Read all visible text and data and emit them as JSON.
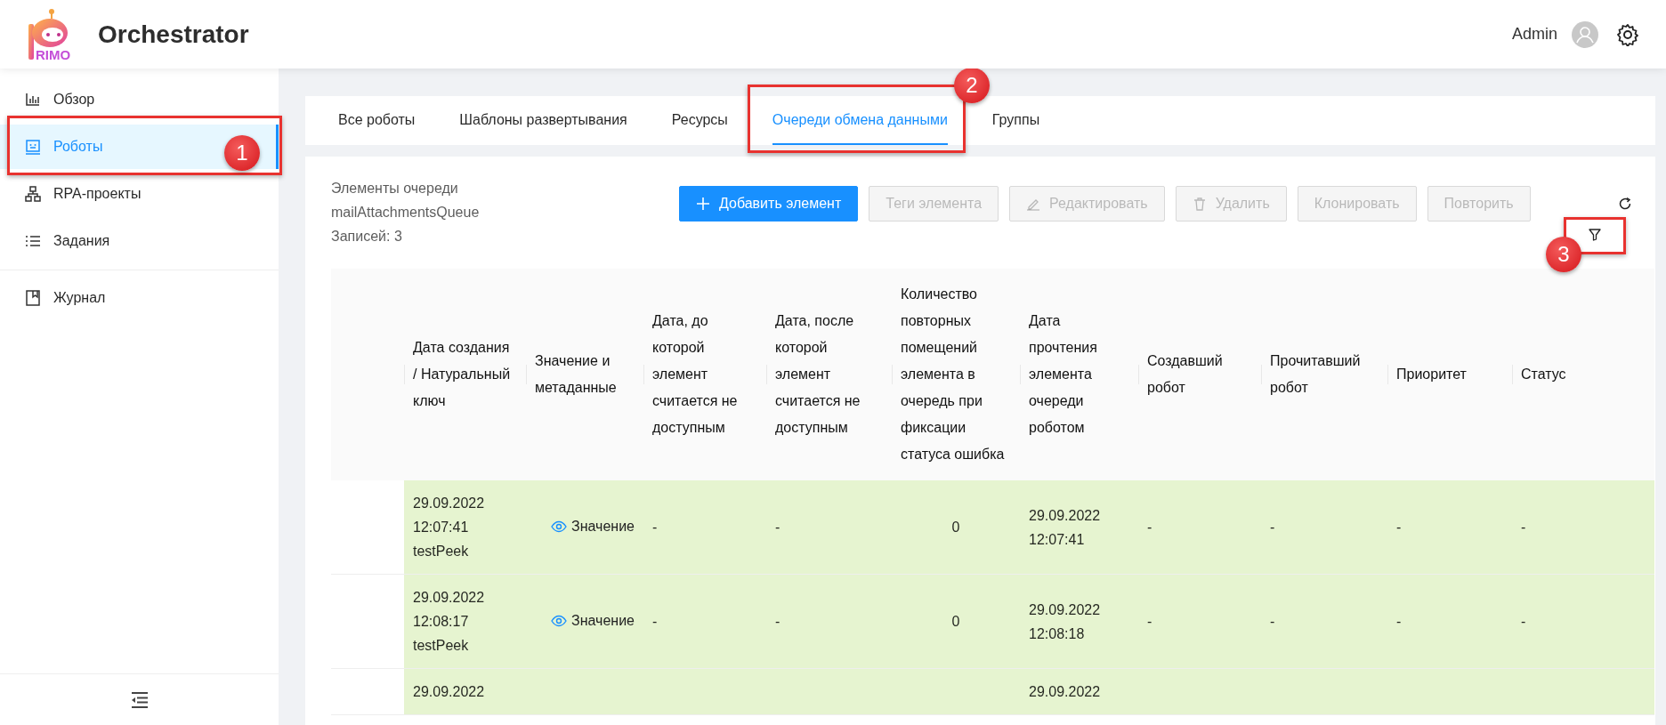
{
  "header": {
    "logo_text": "RIMO",
    "title": "Orchestrator",
    "user": "Admin"
  },
  "sidebar": {
    "sections": [
      {
        "items": [
          {
            "label": "Обзор",
            "kind": "chart",
            "selected": false
          },
          {
            "label": "Роботы",
            "kind": "robot",
            "selected": true,
            "callout": "1"
          },
          {
            "label": "RPA-проекты",
            "kind": "tree",
            "selected": false
          },
          {
            "label": "Задания",
            "kind": "list",
            "selected": false
          }
        ]
      },
      {
        "items": [
          {
            "label": "Журнал",
            "kind": "book",
            "selected": false
          }
        ]
      }
    ]
  },
  "tabs": [
    {
      "label": "Все роботы",
      "selected": false
    },
    {
      "label": "Шаблоны развертывания",
      "selected": false
    },
    {
      "label": "Ресурсы",
      "selected": false
    },
    {
      "label": "Очереди обмена данными",
      "selected": true,
      "callout": "2"
    },
    {
      "label": "Группы",
      "selected": false
    }
  ],
  "queue": {
    "caption": "Элементы очереди",
    "name": "mailAttachmentsQueue",
    "count": "Записей: 3"
  },
  "toolbar": [
    {
      "label": "Добавить элемент",
      "kind": "add",
      "primary": true,
      "disabled": false
    },
    {
      "label": "Теги элемента",
      "kind": "tags",
      "primary": false,
      "disabled": true
    },
    {
      "label": "Редактировать",
      "kind": "edit",
      "primary": false,
      "disabled": true
    },
    {
      "label": "Удалить",
      "kind": "delete",
      "primary": false,
      "disabled": true
    },
    {
      "label": "Клонировать",
      "kind": "clone",
      "primary": false,
      "disabled": true
    },
    {
      "label": "Повторить",
      "kind": "retry",
      "primary": false,
      "disabled": true
    }
  ],
  "filter": {
    "callout": "3"
  },
  "table": {
    "columns": [
      "Дата создания / Натуральный ключ",
      "Значение и метаданные",
      "Дата, до которой элемент считается не доступным",
      "Дата, после которой элемент считается не доступным",
      "Количество повторных помещений элемента в очередь при фиксации статуса ошибка",
      "Дата прочтения элемента очереди роботом",
      "Создавший робот",
      "Прочитавший робот",
      "Приоритет",
      "Статус"
    ],
    "rows": [
      {
        "highlighted": true,
        "created": "29.09.2022 12:07:41",
        "natural_key": "testPeek",
        "value": "Значение",
        "unavailable_before": "-",
        "unavailable_after": "-",
        "retries": "0",
        "read_at": "29.09.2022 12:07:41",
        "created_by": "-",
        "read_by": "-",
        "priority": "-",
        "status": "-"
      },
      {
        "highlighted": true,
        "created": "29.09.2022 12:08:17",
        "natural_key": "testPeek",
        "value": "Значение",
        "unavailable_before": "-",
        "unavailable_after": "-",
        "retries": "0",
        "read_at": "29.09.2022 12:08:18",
        "created_by": "-",
        "read_by": "-",
        "priority": "-",
        "status": "-"
      },
      {
        "highlighted": true,
        "created": "29.09.2022",
        "read_at": "29.09.2022"
      }
    ]
  }
}
